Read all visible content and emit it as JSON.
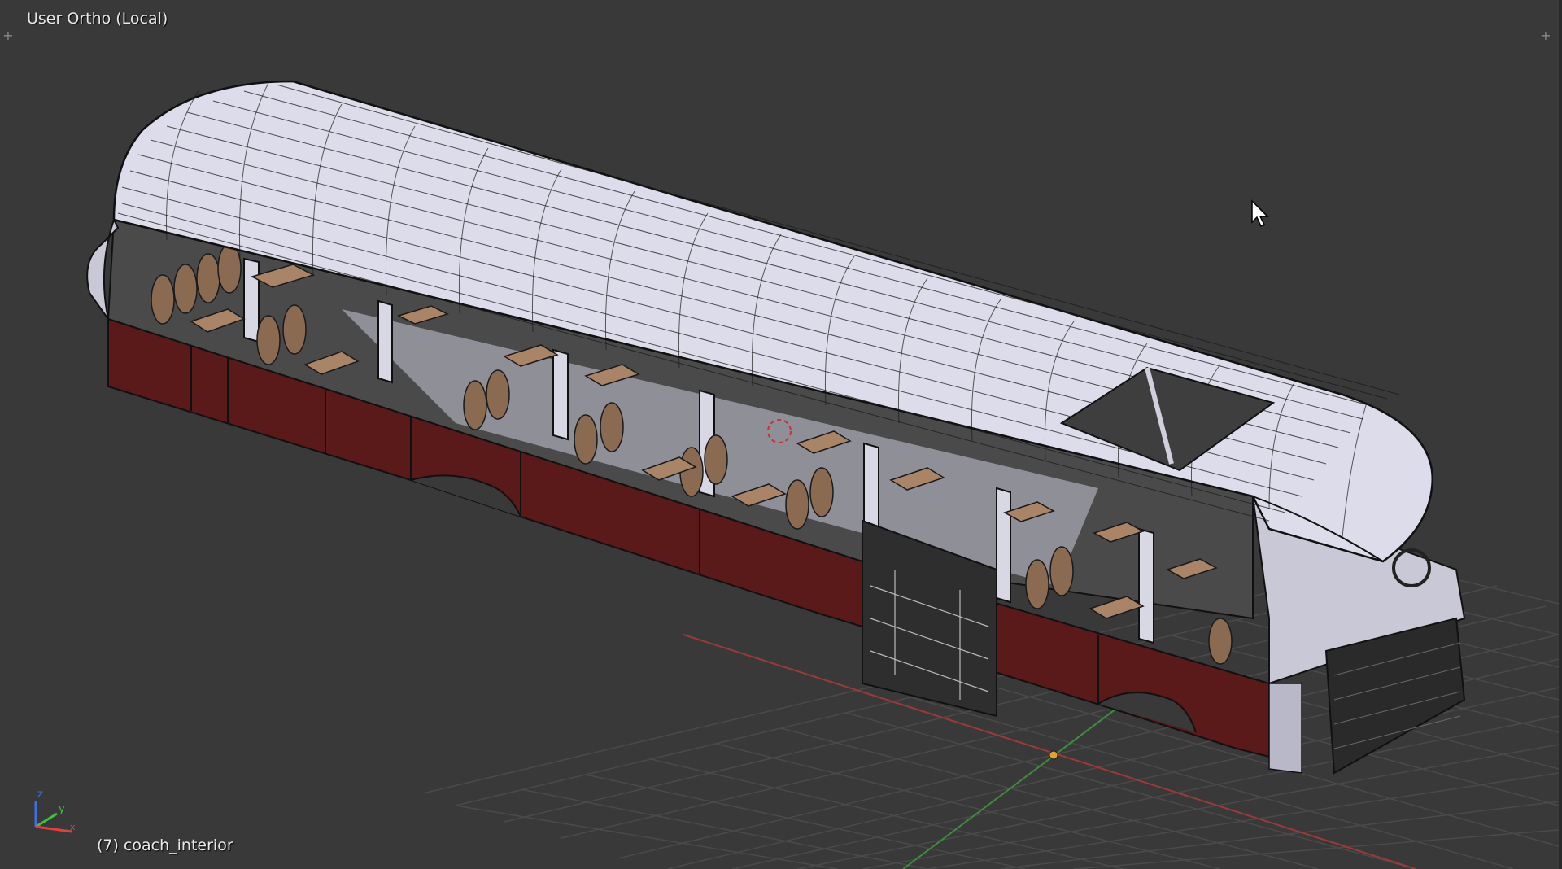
{
  "viewport": {
    "view_label": "User Ortho (Local)",
    "object_label": "(7) coach_interior",
    "corner_widget_glyph": "+",
    "cursor_icon": "mouse-pointer-icon",
    "gizmo_icon": "axis-gizmo-icon",
    "scene_object": "coach-bus-mesh",
    "colors": {
      "background": "#393939",
      "grid": "#4a4a4a",
      "x_axis": "#9a3a3a",
      "y_axis": "#3f8a3f",
      "body_red": "#5a1a1a",
      "roof_white": "#dcdcea",
      "wire": "#111111",
      "seat": "#8a6a50",
      "origin": "#e6a030"
    }
  }
}
